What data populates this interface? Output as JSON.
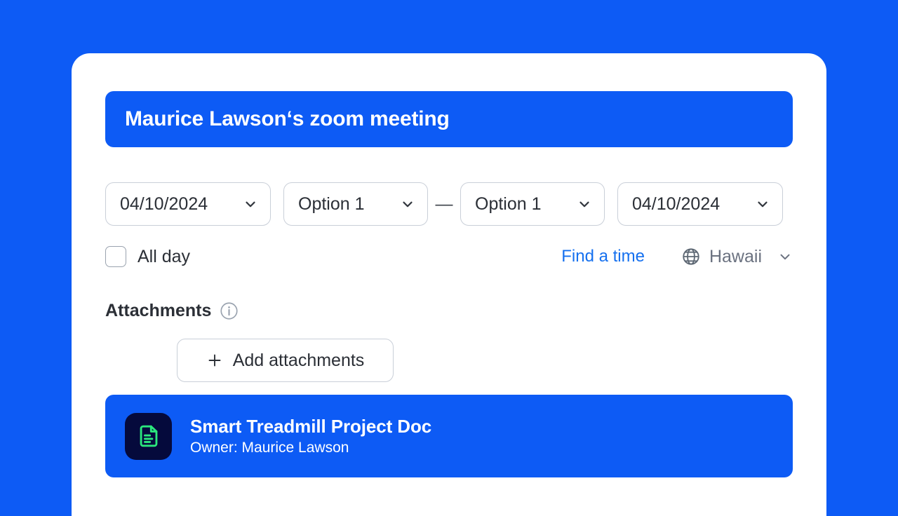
{
  "theme": {
    "page_background": "#0D5BF5",
    "card_background": "#FFFFFF",
    "accent_blue": "#0D5BF5",
    "link_blue": "#1570EF",
    "border_gray": "#C9CFD8",
    "text_dark": "#2B2F36",
    "muted_gray": "#6B7280",
    "doc_tile_navy": "#050A3C",
    "doc_icon_green": "#2BE87D"
  },
  "meeting": {
    "title": "Maurice Lawson‘s zoom meeting"
  },
  "schedule": {
    "start_date": {
      "value": "04/10/2024",
      "icon": "chevron-down-icon"
    },
    "start_time": {
      "value": "Option 1",
      "icon": "chevron-down-icon"
    },
    "range_separator": "—",
    "end_time": {
      "value": "Option 1",
      "icon": "chevron-down-icon"
    },
    "end_date": {
      "value": "04/10/2024",
      "icon": "chevron-down-icon"
    }
  },
  "options": {
    "all_day": {
      "label": "All day",
      "checked": false
    },
    "find_a_time": "Find a time",
    "timezone": {
      "icon": "globe-icon",
      "label": "Hawaii",
      "chevron": "chevron-down-icon"
    }
  },
  "attachments": {
    "section_title": "Attachments",
    "info_icon": "info-circle-icon",
    "add_button": {
      "label": "Add attachments",
      "icon": "plus-icon"
    },
    "items": [
      {
        "icon": "document-icon",
        "name": "Smart Treadmill Project Doc",
        "owner": "Owner: Maurice Lawson"
      }
    ]
  }
}
